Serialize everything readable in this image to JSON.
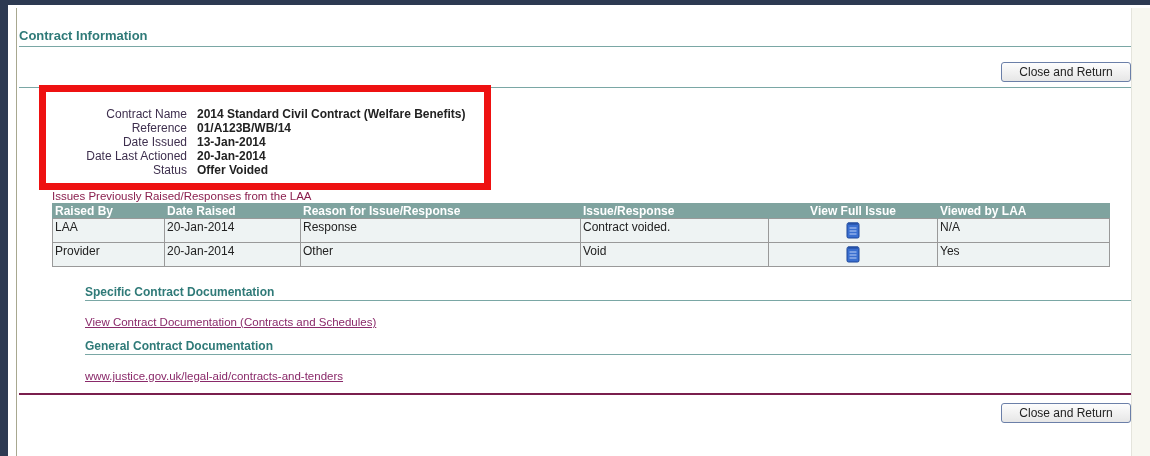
{
  "title": "Contract Information",
  "close_button_top": "Close and Return",
  "details": {
    "highlighted": true,
    "fields": [
      {
        "label": "Contract Name",
        "value": "2014 Standard Civil Contract (Welfare Benefits)"
      },
      {
        "label": "Reference",
        "value": "01/A123B/WB/14"
      },
      {
        "label": "Date Issued",
        "value": "13-Jan-2014"
      },
      {
        "label": "Date Last Actioned",
        "value": "20-Jan-2014"
      },
      {
        "label": "Status",
        "value": "Offer Voided"
      }
    ]
  },
  "issues": {
    "caption": "Issues Previously Raised/Responses from the LAA",
    "columns": [
      "Raised By",
      "Date Raised",
      "Reason for Issue/Response",
      "Issue/Response",
      "View Full Issue",
      "Viewed by LAA"
    ],
    "rows": [
      {
        "raised_by": "LAA",
        "date_raised": "20-Jan-2014",
        "reason": "Response",
        "issue": "Contract voided.",
        "viewed": "N/A"
      },
      {
        "raised_by": "Provider",
        "date_raised": "20-Jan-2014",
        "reason": "Other",
        "issue": "Void",
        "viewed": "Yes"
      }
    ]
  },
  "sections": [
    {
      "heading": "Specific Contract Documentation",
      "link": "View Contract Documentation (Contracts and Schedules)"
    },
    {
      "heading": "General Contract Documentation",
      "link": "www.justice.gov.uk/legal-aid/contracts-and-tenders"
    }
  ],
  "close_button_bottom": "Close and Return"
}
